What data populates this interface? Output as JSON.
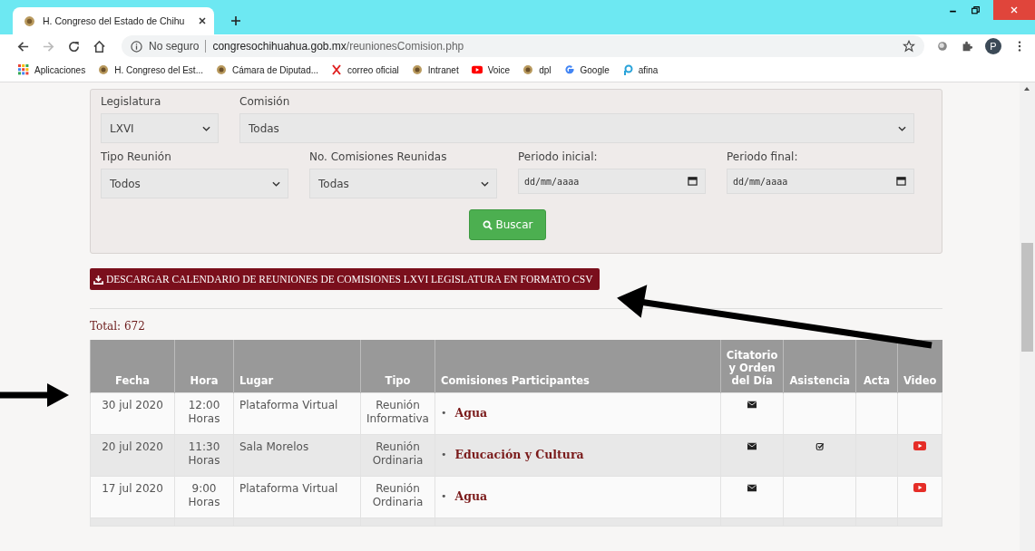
{
  "browser": {
    "tab_title": "H. Congreso del Estado de Chihu",
    "security": "No seguro",
    "url_host": "congresochihuahua.gob.mx",
    "url_path": "/reunionesComision.php",
    "profile": "P",
    "bookmarks": [
      {
        "label": "Aplicaciones",
        "kind": "apps"
      },
      {
        "label": "H. Congreso del Est...",
        "kind": "seal"
      },
      {
        "label": "Cámara de Diputad...",
        "kind": "seal"
      },
      {
        "label": "correo oficial",
        "kind": "x"
      },
      {
        "label": "Intranet",
        "kind": "seal"
      },
      {
        "label": "Voice",
        "kind": "youtube"
      },
      {
        "label": "dpl",
        "kind": "seal"
      },
      {
        "label": "Google",
        "kind": "google"
      },
      {
        "label": "afina",
        "kind": "afina"
      }
    ]
  },
  "filters": {
    "legislatura": {
      "label": "Legislatura",
      "value": "LXVI"
    },
    "comision": {
      "label": "Comisión",
      "value": "Todas"
    },
    "tipo": {
      "label": "Tipo Reunión",
      "value": "Todos"
    },
    "numero": {
      "label": "No. Comisiones Reunidas",
      "value": "Todas"
    },
    "inicio": {
      "label": "Periodo inicial:",
      "placeholder": "dd/mm/aaaa"
    },
    "fin": {
      "label": "Periodo final:",
      "placeholder": "dd/mm/aaaa"
    },
    "search_button": "Buscar"
  },
  "download_button": "DESCARGAR CALENDARIO DE REUNIONES DE COMISIONES LXVI LEGISLATURA EN FORMATO CSV",
  "total": "Total: 672",
  "table": {
    "columns": [
      "Fecha",
      "Hora",
      "Lugar",
      "Tipo",
      "Comisiones Participantes",
      "Citatorio y Orden del Día",
      "Asistencia",
      "Acta",
      "Video"
    ],
    "rows": [
      {
        "fecha": "30 jul 2020",
        "hora": [
          "12:00",
          "Horas"
        ],
        "lugar": "Plataforma Virtual",
        "tipo": [
          "Reunión",
          "Informativa"
        ],
        "comisiones": [
          {
            "marker": "•",
            "name": "Agua"
          }
        ],
        "citatorio": true,
        "asistencia": false,
        "video": false
      },
      {
        "fecha": "20 jul 2020",
        "hora": [
          "11:30",
          "Horas"
        ],
        "lugar": "Sala Morelos",
        "tipo": [
          "Reunión",
          "Ordinaria"
        ],
        "comisiones": [
          {
            "marker": "•",
            "name": "Educación y Cultura"
          }
        ],
        "citatorio": true,
        "asistencia": true,
        "video": true
      },
      {
        "fecha": "17 jul 2020",
        "hora": [
          "9:00",
          "Horas"
        ],
        "lugar": "Plataforma Virtual",
        "tipo": [
          "Reunión",
          "Ordinaria"
        ],
        "comisiones": [
          {
            "marker": "•",
            "name": "Agua"
          }
        ],
        "citatorio": true,
        "asistencia": false,
        "video": true
      }
    ]
  }
}
